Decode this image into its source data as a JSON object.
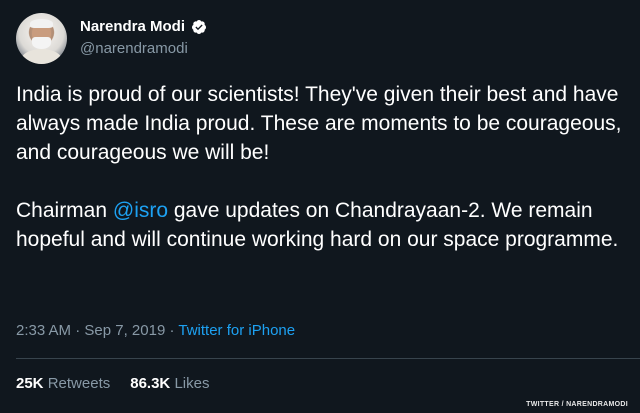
{
  "author": {
    "display_name": "Narendra Modi",
    "handle": "@narendramodi",
    "verified_icon": "verified-badge-icon"
  },
  "tweet": {
    "paragraph1": "India is proud of our scientists! They've given their best and have always made India proud. These are moments to be courageous, and courageous we will be!",
    "p2_before": "Chairman ",
    "p2_mention": "@isro",
    "p2_after": " gave updates on Chandrayaan-2. We remain hopeful and will continue working hard on our space programme."
  },
  "meta": {
    "time": "2:33 AM",
    "date": "Sep 7, 2019",
    "separator": "·",
    "source": "Twitter for iPhone"
  },
  "stats": {
    "retweets_count": "25K",
    "retweets_label": "Retweets",
    "likes_count": "86.3K",
    "likes_label": "Likes"
  },
  "credit": "TWITTER / NARENDRAMODI",
  "colors": {
    "background": "#10171e",
    "accent": "#1da1f2",
    "muted": "#8899a6"
  }
}
